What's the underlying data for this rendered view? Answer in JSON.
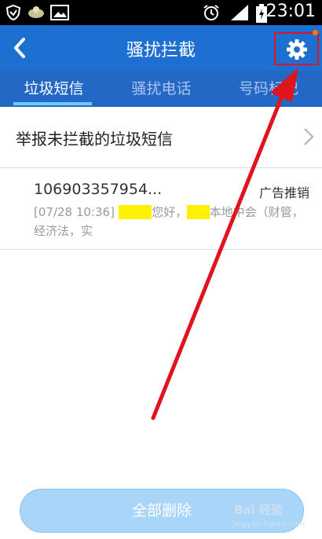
{
  "status_bar": {
    "time": "23:01",
    "icons": [
      "shield-icon",
      "cloud-icon",
      "image-icon",
      "alarm-icon",
      "signal-icon",
      "battery-icon"
    ]
  },
  "action_bar": {
    "title": "骚扰拦截",
    "back_icon": "chevron-left-icon",
    "settings_icon": "gear-icon"
  },
  "tabs": [
    {
      "label": "垃圾短信",
      "selected": true
    },
    {
      "label": "骚扰电话",
      "selected": false
    },
    {
      "label": "号码标记",
      "selected": false
    }
  ],
  "report_row": {
    "label": "举报未拦截的垃圾短信"
  },
  "messages": [
    {
      "sender": "106903357954...",
      "tag": "广告推销",
      "time": "[07/28 10:36]",
      "preview_a": "您好，",
      "preview_b": "本地中会（财管，经济法，实"
    }
  ],
  "footer": {
    "delete_all_label": "全部删除"
  },
  "watermark": {
    "brand": "Bai 经验",
    "url": "jingyan.baidu.com"
  },
  "colors": {
    "action_bar": "#1d6fd1",
    "tab_bar": "#2468c6",
    "tab_indicator": "#6ecbff",
    "annotation": "#e0141e",
    "highlight": "#fff200"
  }
}
